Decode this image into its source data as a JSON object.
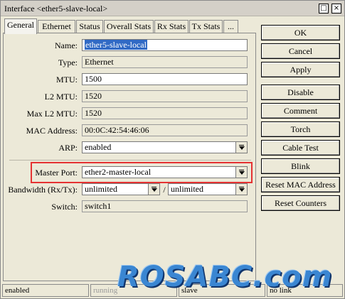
{
  "window": {
    "title": "Interface <ether5-slave-local>",
    "restore_glyph": "□",
    "close_glyph": "×"
  },
  "tabs": [
    "General",
    "Ethernet",
    "Status",
    "Overall Stats",
    "Rx Stats",
    "Tx Stats",
    "..."
  ],
  "form": {
    "name_label": "Name:",
    "name_value": "ether5-slave-local",
    "type_label": "Type:",
    "type_value": "Ethernet",
    "mtu_label": "MTU:",
    "mtu_value": "1500",
    "l2mtu_label": "L2 MTU:",
    "l2mtu_value": "1520",
    "maxl2mtu_label": "Max L2 MTU:",
    "maxl2mtu_value": "1520",
    "mac_label": "MAC Address:",
    "mac_value": "00:0C:42:54:46:06",
    "arp_label": "ARP:",
    "arp_value": "enabled",
    "master_label": "Master Port:",
    "master_value": "ether2-master-local",
    "bandwidth_label": "Bandwidth (Rx/Tx):",
    "bandwidth_rx": "unlimited",
    "bandwidth_sep": "/",
    "bandwidth_tx": "unlimited",
    "switch_label": "Switch:",
    "switch_value": "switch1"
  },
  "buttons": {
    "ok": "OK",
    "cancel": "Cancel",
    "apply": "Apply",
    "disable": "Disable",
    "comment": "Comment",
    "torch": "Torch",
    "cable_test": "Cable Test",
    "blink": "Blink",
    "reset_mac": "Reset MAC Address",
    "reset_counters": "Reset Counters"
  },
  "status": {
    "state": "enabled",
    "running": "running",
    "role": "slave",
    "link": "no link"
  },
  "watermark": "ROSABC.com",
  "colors": {
    "highlight": "#e53333",
    "selection": "#316ac5",
    "watermark": "#3a86d2"
  }
}
